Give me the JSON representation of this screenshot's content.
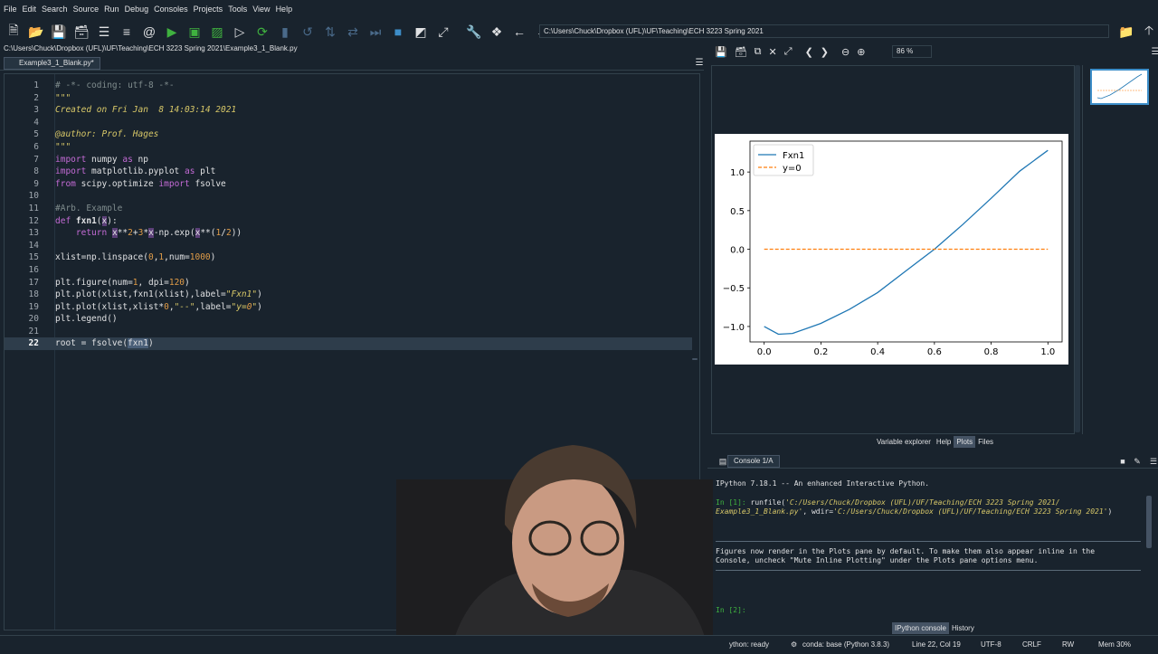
{
  "menu": [
    "File",
    "Edit",
    "Search",
    "Source",
    "Run",
    "Debug",
    "Consoles",
    "Projects",
    "Tools",
    "View",
    "Help"
  ],
  "toolbar": {
    "path": "C:\\Users\\Chuck\\Dropbox (UFL)\\UF\\Teaching\\ECH 3223 Spring 2021"
  },
  "editor": {
    "file_path": "C:\\Users\\Chuck\\Dropbox (UFL)\\UF\\Teaching\\ECH 3223 Spring 2021\\Example3_1_Blank.py",
    "tab_label": "Example3_1_Blank.py*",
    "lines": [
      {
        "n": "1",
        "text": "# -*- coding: utf-8 -*-"
      },
      {
        "n": "2",
        "text": "\"\"\""
      },
      {
        "n": "3",
        "text": "Created on Fri Jan  8 14:03:14 2021"
      },
      {
        "n": "4",
        "text": ""
      },
      {
        "n": "5",
        "text": "@author: Prof. Hages"
      },
      {
        "n": "6",
        "text": "\"\"\""
      },
      {
        "n": "7",
        "text": "import numpy as np"
      },
      {
        "n": "8",
        "text": "import matplotlib.pyplot as plt"
      },
      {
        "n": "9",
        "text": "from scipy.optimize import fsolve"
      },
      {
        "n": "10",
        "text": ""
      },
      {
        "n": "11",
        "text": "#Arb. Example"
      },
      {
        "n": "12",
        "text": "def fxn1(x):"
      },
      {
        "n": "13",
        "text": "    return x**2+3*x-np.exp(x**(1/2))"
      },
      {
        "n": "14",
        "text": ""
      },
      {
        "n": "15",
        "text": "xlist=np.linspace(0,1,num=1000)"
      },
      {
        "n": "16",
        "text": ""
      },
      {
        "n": "17",
        "text": "plt.figure(num=1, dpi=120)"
      },
      {
        "n": "18",
        "text": "plt.plot(xlist,fxn1(xlist),label=\"Fxn1\")"
      },
      {
        "n": "19",
        "text": "plt.plot(xlist,xlist*0,\"--\",label=\"y=0\")"
      },
      {
        "n": "20",
        "text": "plt.legend()"
      },
      {
        "n": "21",
        "text": ""
      },
      {
        "n": "22",
        "text": "root = fsolve(fxn1)"
      }
    ]
  },
  "plots": {
    "zoom": "86 %"
  },
  "chart_data": {
    "type": "line",
    "x": [
      0.0,
      0.05,
      0.1,
      0.2,
      0.3,
      0.4,
      0.5,
      0.6,
      0.7,
      0.8,
      0.9,
      1.0
    ],
    "series": [
      {
        "name": "Fxn1",
        "color": "#1f77b4",
        "style": "solid",
        "values": [
          -1.0,
          -1.1,
          -1.09,
          -0.96,
          -0.78,
          -0.56,
          -0.28,
          0.0,
          0.32,
          0.66,
          1.01,
          1.28
        ]
      },
      {
        "name": "y=0",
        "color": "#ff7f0e",
        "style": "dashed",
        "values": [
          0,
          0,
          0,
          0,
          0,
          0,
          0,
          0,
          0,
          0,
          0,
          0
        ]
      }
    ],
    "xticks": [
      "0.0",
      "0.2",
      "0.4",
      "0.6",
      "0.8",
      "1.0"
    ],
    "yticks": [
      "1.0",
      "0.5",
      "0.0",
      "-0.5",
      "-1.0"
    ],
    "xlim": [
      -0.05,
      1.05
    ],
    "ylim": [
      -1.2,
      1.4
    ],
    "legend": "top-left"
  },
  "pane_tabs": [
    "Variable explorer",
    "Help",
    "Plots",
    "Files"
  ],
  "console": {
    "tab_label": "Console 1/A",
    "banner": "IPython 7.18.1 -- An enhanced Interactive Python.",
    "in1_prompt": "In [1]:",
    "in1_cmd": "runfile(",
    "in1_arg1": "'C:/Users/Chuck/Dropbox (UFL)/UF/Teaching/ECH 3223 Spring 2021/",
    "in1_arg1b": "Example3_1_Blank.py'",
    "in1_mid": ", wdir=",
    "in1_arg2": "'C:/Users/Chuck/Dropbox (UFL)/UF/Teaching/ECH 3223 Spring 2021'",
    "in1_close": ")",
    "msg1": "Figures now render in the Plots pane by default. To make them also appear inline in the",
    "msg2": "Console, uncheck \"Mute Inline Plotting\" under the Plots pane options menu.",
    "in2_prompt": "In [2]:"
  },
  "bottom_tabs": [
    "IPython console",
    "History"
  ],
  "status": {
    "kernel": "ython: ready",
    "conda": "conda: base (Python 3.8.3)",
    "position": "Line 22, Col 19",
    "encoding": "UTF-8",
    "eol": "CRLF",
    "rw": "RW",
    "mem": "Mem 30%"
  }
}
